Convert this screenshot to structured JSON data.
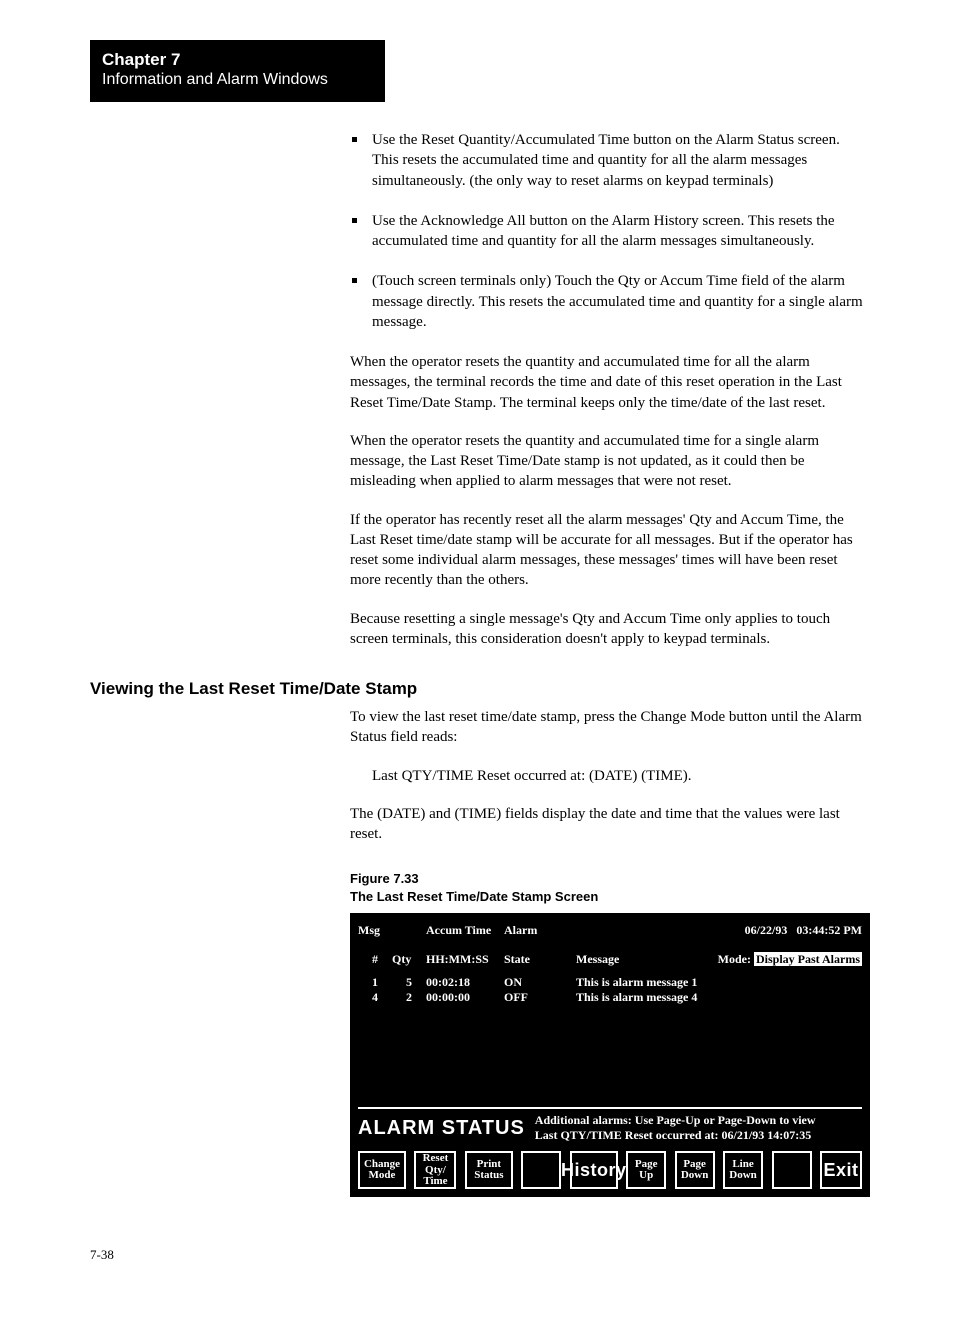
{
  "chapter": {
    "title": "Chapter 7",
    "subtitle": "Information and Alarm Windows"
  },
  "bullets": [
    "Use the Reset Quantity/Accumulated Time button on the Alarm Status screen. This resets the accumulated time and quantity for all the alarm messages simultaneously. (the only way to reset alarms on keypad terminals)",
    "Use the Acknowledge All button on the Alarm History screen. This resets the accumulated time and quantity for all the alarm messages simultaneously.",
    "(Touch screen terminals only) Touch the Qty or Accum Time field of the alarm message directly. This resets the accumulated time and quantity for a single alarm message."
  ],
  "paragraphs": {
    "p1": "When the operator resets the quantity and accumulated time for all the alarm messages, the terminal records the time and date of this reset operation in the Last Reset Time/Date Stamp. The terminal keeps only the time/date of the last reset.",
    "p2": "When the operator resets the quantity and accumulated time for a single alarm message, the Last Reset Time/Date stamp is not updated, as it could then be misleading when applied to alarm messages that were not reset.",
    "p3": "If the operator has recently reset all the alarm messages' Qty and Accum Time, the Last Reset time/date stamp will be accurate for all messages. But if the operator has reset some individual alarm messages, these messages' times will have been reset more recently than the others.",
    "p4": "Because resetting a single message's Qty and Accum Time only applies to touch screen terminals, this consideration doesn't apply to keypad terminals."
  },
  "subHeading": "Viewing the Last Reset Time/Date Stamp",
  "afterHeading": "To view the last reset time/date stamp, press the Change Mode button until the Alarm Status field reads:",
  "modeLine": "Last QTY/TIME Reset occurred at: (DATE) (TIME).",
  "afterMode": "The (DATE) and (TIME) fields display the date and time that the values were last reset.",
  "figure": {
    "num": "Figure 7.33",
    "title": "The Last Reset Time/Date Stamp Screen"
  },
  "terminal": {
    "date": "06/22/93",
    "time": "03:44:52 PM",
    "headers": {
      "msg": "Msg",
      "hash": "#",
      "qty": "Qty",
      "accum": "Accum Time",
      "hhmmss": "HH:MM:SS",
      "alarm": "Alarm",
      "state": "State",
      "message": "Message",
      "modeLabel": "Mode:",
      "modeValue": "Display Past Alarms"
    },
    "rows": [
      {
        "msg": "1",
        "qty": "5",
        "time": "00:02:18",
        "state": "ON",
        "message": "This is alarm message 1"
      },
      {
        "msg": "4",
        "qty": "2",
        "time": "00:00:00",
        "state": "OFF",
        "message": "This is alarm message 4"
      }
    ],
    "statusLabel": "ALARM  STATUS",
    "statusMsg1": "Additional alarms:  Use Page-Up or Page-Down to view",
    "statusMsg2": "Last QTY/TIME Reset occurred at:  06/21/93 14:07:35",
    "buttons": {
      "changeMode": "Change\nMode",
      "resetQtyTime": "Reset\nQty/\nTime",
      "printStatus": "Print\nStatus",
      "history": "History",
      "pageUp": "Page\nUp",
      "pageDown": "Page\nDown",
      "lineDown": "Line\nDown",
      "exit": "Exit"
    }
  },
  "pageNumber": "7-38"
}
